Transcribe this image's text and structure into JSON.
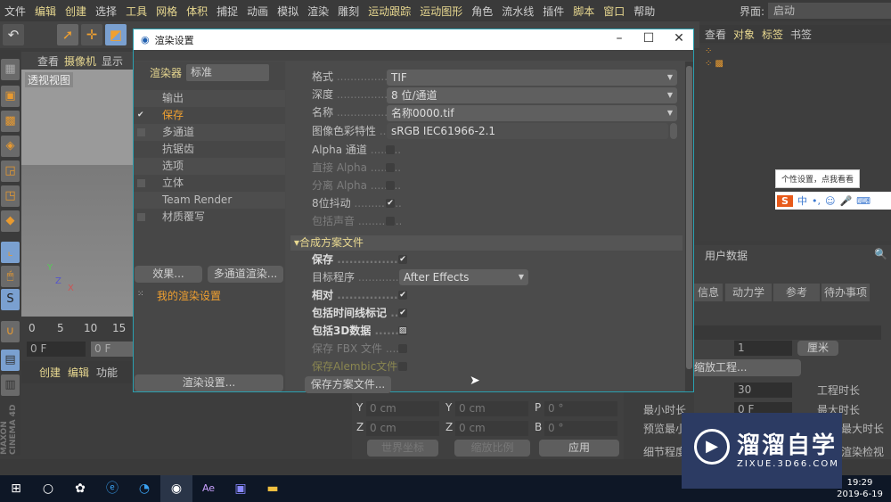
{
  "menu": [
    {
      "l": "文件",
      "h": false
    },
    {
      "l": "编辑",
      "h": true
    },
    {
      "l": "创建",
      "h": true
    },
    {
      "l": "选择",
      "h": false
    },
    {
      "l": "工具",
      "h": true
    },
    {
      "l": "网格",
      "h": true
    },
    {
      "l": "体积",
      "h": true
    },
    {
      "l": "捕捉",
      "h": false
    },
    {
      "l": "动画",
      "h": false
    },
    {
      "l": "模拟",
      "h": false
    },
    {
      "l": "渲染",
      "h": false
    },
    {
      "l": "雕刻",
      "h": false
    },
    {
      "l": "运动跟踪",
      "h": true
    },
    {
      "l": "运动图形",
      "h": true
    },
    {
      "l": "角色",
      "h": false
    },
    {
      "l": "流水线",
      "h": false
    },
    {
      "l": "插件",
      "h": false
    },
    {
      "l": "脚本",
      "h": true
    },
    {
      "l": "窗口",
      "h": true
    },
    {
      "l": "帮助",
      "h": false
    }
  ],
  "layout": {
    "label": "界面:",
    "value": "启动"
  },
  "viewport": {
    "menu": [
      "查看",
      "摄像机",
      "显示"
    ],
    "label": "透视视图",
    "axes": [
      "Y",
      "Z",
      "X"
    ]
  },
  "timeline": {
    "ticks": [
      "0",
      "5",
      "10",
      "15"
    ],
    "start": "0 F",
    "cur": "0 F"
  },
  "material": {
    "menu": [
      "创建",
      "编辑",
      "功能"
    ]
  },
  "dialog": {
    "title": "渲染设置",
    "renderer_label": "渲染器",
    "renderer": "标准",
    "tree": [
      {
        "l": "输出",
        "c": ""
      },
      {
        "l": "保存",
        "c": "✔",
        "active": true
      },
      {
        "l": "多通道",
        "c": " "
      },
      {
        "l": "抗锯齿",
        "c": ""
      },
      {
        "l": "选项",
        "c": ""
      },
      {
        "l": "立体",
        "c": " "
      },
      {
        "l": "Team Render",
        "c": ""
      },
      {
        "l": "材质覆写",
        "c": " "
      }
    ],
    "effects_btn": "效果...",
    "multipass_btn": "多通道渲染...",
    "preset": "我的渲染设置",
    "render_settings_btn": "渲染设置...",
    "format_label": "格式",
    "format": "TIF",
    "depth_label": "深度",
    "depth": "8 位/通道",
    "name_label": "名称",
    "name": "名称0000.tif",
    "profile_label": "图像色彩特性",
    "profile": "sRGB IEC61966-2.1",
    "alpha": "Alpha 通道",
    "straight_alpha": "直接 Alpha",
    "separate_alpha": "分离 Alpha",
    "dither": "8位抖动",
    "sound": "包括声音",
    "comp_section": "合成方案文件",
    "comp_save": "保存",
    "target_label": "目标程序",
    "target": "After Effects",
    "relative": "相对",
    "timeline_marks": "包括时间线标记",
    "data3d": "包括3D数据",
    "fbx": "保存 FBX 文件",
    "alembic": "保存Alembic文件",
    "save_comp_btn": "保存方案文件..."
  },
  "objmgr": {
    "menu": [
      "查看",
      "对象",
      "标签",
      "书签"
    ]
  },
  "ime": {
    "tooltip": "个性设置，点我看看",
    "mode": "中"
  },
  "attr": {
    "header": "用户数据",
    "tabs": [
      "信息",
      "动力学",
      "参考",
      "待办事项"
    ],
    "scale": "1",
    "unit": "厘米",
    "scale_btn": "缩放工程...",
    "fps": "30",
    "project_len": "工程时长",
    "min_len": "最小时长",
    "min_val": "0 F",
    "max_len": "最大时长",
    "preview_min": "预览最小",
    "preview_max": "最大时长",
    "lod": "细节程度",
    "render_lod": "渲染检视"
  },
  "coords": {
    "rows": [
      [
        "Y",
        "0 cm",
        "Y",
        "0 cm",
        "P",
        "0 °"
      ],
      [
        "Z",
        "0 cm",
        "Z",
        "0 cm",
        "B",
        "0 °"
      ]
    ],
    "world": "世界坐标",
    "scale": "缩放比例",
    "apply": "应用"
  },
  "taskbar": {
    "time": "19:29",
    "date": "2019-6-19"
  },
  "watermark": {
    "name": "溜溜自学",
    "url": "ZIXUE.3D66.COM"
  },
  "logo": "MAXON CINEMA 4D"
}
